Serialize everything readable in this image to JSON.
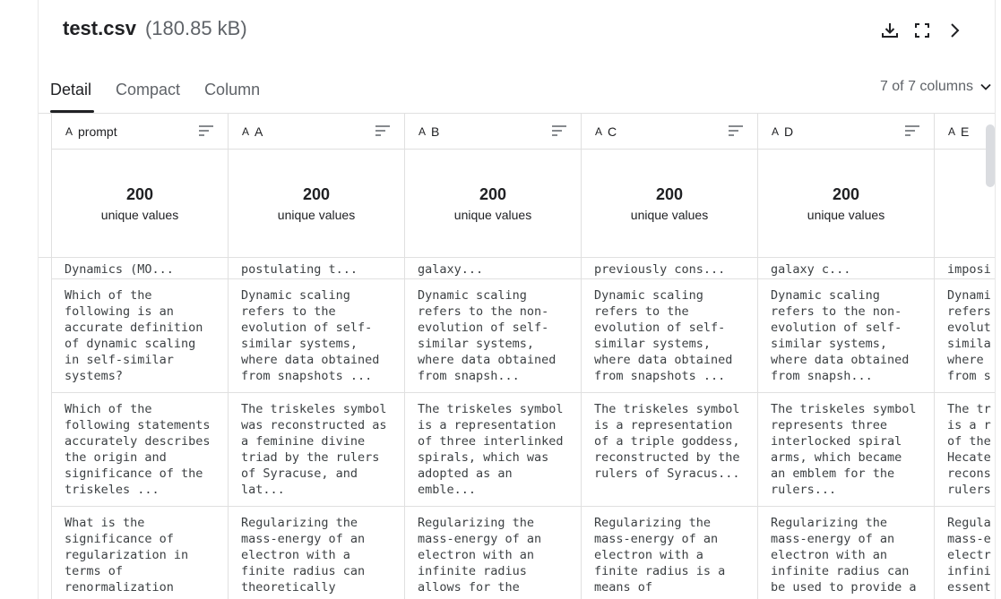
{
  "header": {
    "filename": "test.csv",
    "filesize": "(180.85 kB)"
  },
  "icons": {
    "download": "download-icon",
    "fullscreen": "fullscreen-icon",
    "next": "chevron-right-icon"
  },
  "tabs": [
    {
      "label": "Detail"
    },
    {
      "label": "Compact"
    },
    {
      "label": "Column"
    }
  ],
  "column_selector": {
    "label": "7 of 7 columns"
  },
  "columns": [
    {
      "name": "prompt",
      "type": "A",
      "stat_value": "200",
      "stat_label": "unique values"
    },
    {
      "name": "A",
      "type": "A",
      "stat_value": "200",
      "stat_label": "unique values"
    },
    {
      "name": "B",
      "type": "A",
      "stat_value": "200",
      "stat_label": "unique values"
    },
    {
      "name": "C",
      "type": "A",
      "stat_value": "200",
      "stat_label": "unique values"
    },
    {
      "name": "D",
      "type": "A",
      "stat_value": "200",
      "stat_label": "unique values"
    },
    {
      "name": "E",
      "type": "A",
      "stat_value": "",
      "stat_label": "u"
    }
  ],
  "rows": [
    [
      "Dynamics (MO...",
      "postulating t...",
      "galaxy...",
      "previously cons...",
      "galaxy c...",
      "imposi"
    ],
    [
      "Which of the\nfollowing is an\naccurate definition\nof dynamic scaling\nin self-similar\nsystems?",
      "Dynamic scaling\nrefers to the\nevolution of self-\nsimilar systems,\nwhere data obtained\nfrom snapshots ...",
      "Dynamic scaling\nrefers to the non-\nevolution of self-\nsimilar systems,\nwhere data obtained\nfrom snapsh...",
      "Dynamic scaling\nrefers to the\nevolution of self-\nsimilar systems,\nwhere data obtained\nfrom snapshots ...",
      "Dynamic scaling\nrefers to the non-\nevolution of self-\nsimilar systems,\nwhere data obtained\nfrom snapsh...",
      "Dynami\nrefers\nevolut\nsimila\nwhere\nfrom s"
    ],
    [
      "Which of the\nfollowing statements\naccurately describes\nthe origin and\nsignificance of the\ntriskeles ...",
      "The triskeles symbol\nwas reconstructed as\na feminine divine\ntriad by the rulers\nof Syracuse, and\nlat...",
      "The triskeles symbol\nis a representation\nof three interlinked\nspirals, which was\nadopted as an\nemble...",
      "The triskeles symbol\nis a representation\nof a triple goddess,\nreconstructed by the\nrulers of Syracus...",
      "The triskeles symbol\nrepresents three\ninterlocked spiral\narms, which became\nan emblem for the\nrulers...",
      "The tr\nis a r\nof the\nHecate\nrecons\nrulers"
    ],
    [
      "What is the\nsignificance of\nregularization in\nterms of\nrenormalization",
      "Regularizing the\nmass-energy of an\nelectron with a\nfinite radius can\ntheoretically",
      "Regularizing the\nmass-energy of an\nelectron with an\ninfinite radius\nallows for the",
      "Regularizing the\nmass-energy of an\nelectron with a\nfinite radius is a\nmeans of",
      "Regularizing the\nmass-energy of an\nelectron with an\ninfinite radius can\nbe used to provide a",
      "Regula\nmass-e\nelectr\ninfini\nessent"
    ]
  ]
}
